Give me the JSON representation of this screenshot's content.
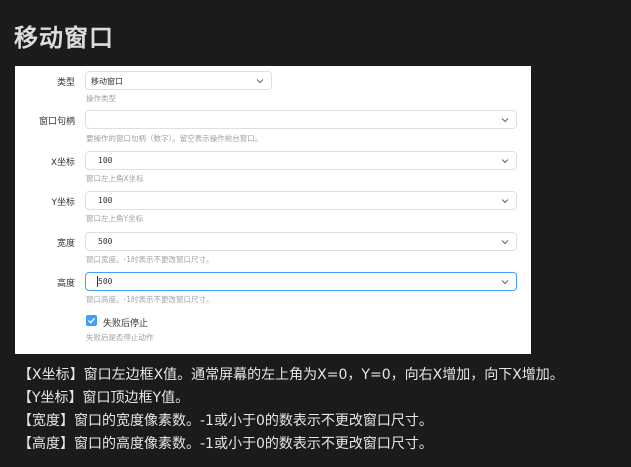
{
  "page": {
    "title": "移动窗口"
  },
  "form": {
    "type": {
      "label": "类型",
      "value": "移动窗口",
      "help": "操作类型"
    },
    "handle": {
      "label": "窗口句柄",
      "value": "",
      "help": "要操作的窗口句柄（数字）。留空表示操作前台窗口。"
    },
    "x": {
      "label": "X坐标",
      "value": "100",
      "help": "窗口左上角X坐标"
    },
    "y": {
      "label": "Y坐标",
      "value": "100",
      "help": "窗口左上角Y坐标"
    },
    "width": {
      "label": "宽度",
      "value": "500",
      "help": "窗口宽度。-1时表示不更改窗口尺寸。"
    },
    "height": {
      "label": "高度",
      "value": "500",
      "help": "窗口高度。-1时表示不更改窗口尺寸。"
    },
    "stop_on_fail": {
      "label": "失败后停止",
      "checked": true,
      "help": "失败后是否停止动作"
    }
  },
  "descriptions": [
    "【X坐标】窗口左边框X值。通常屏幕的左上角为X=0，Y=0，向右X增加，向下X增加。",
    "【Y坐标】窗口顶边框Y值。",
    "【宽度】窗口的宽度像素数。-1或小于0的数表示不更改窗口尺寸。",
    "【高度】窗口的高度像素数。-1或小于0的数表示不更改窗口尺寸。"
  ],
  "colors": {
    "accent": "#409eff",
    "background": "#1b1b1b",
    "panel": "#ffffff"
  }
}
